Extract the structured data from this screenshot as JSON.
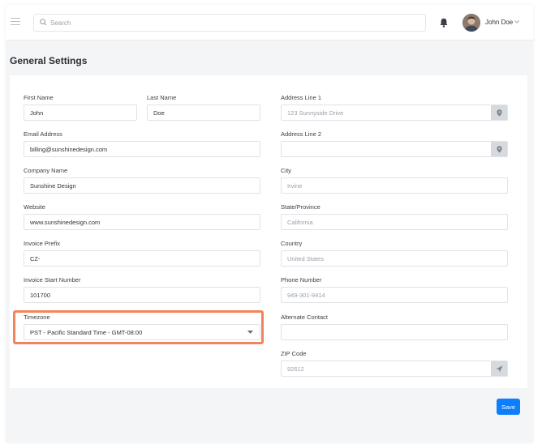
{
  "search": {
    "placeholder": "Search"
  },
  "user": {
    "name": "John Doe"
  },
  "page": {
    "title": "General Settings"
  },
  "form": {
    "first_name": {
      "label": "First Name",
      "value": "John"
    },
    "last_name": {
      "label": "Last Name",
      "value": "Doe"
    },
    "email": {
      "label": "Email Address",
      "value": "billing@sunshinedesign.com"
    },
    "company": {
      "label": "Company Name",
      "value": "Sunshine Design"
    },
    "website": {
      "label": "Website",
      "value": "www.sunshinedesign.com"
    },
    "invoice_prefix": {
      "label": "Invoice Prefix",
      "value": "CZ-"
    },
    "invoice_start": {
      "label": "Invoice Start Number",
      "value": "101700"
    },
    "timezone": {
      "label": "Timezone",
      "value": "PST - Pacific Standard Time - GMT-08:00"
    },
    "address1": {
      "label": "Address Line 1",
      "placeholder": "123 Sunnyside Drive"
    },
    "address2": {
      "label": "Address Line 2",
      "placeholder": ""
    },
    "city": {
      "label": "City",
      "placeholder": "Irvine"
    },
    "state": {
      "label": "State/Province",
      "placeholder": "California"
    },
    "country": {
      "label": "Country",
      "placeholder": "United States"
    },
    "phone": {
      "label": "Phone Number",
      "placeholder": "949-301-9414"
    },
    "alt_contact": {
      "label": "Alternate Contact",
      "placeholder": ""
    },
    "zip": {
      "label": "ZIP Code",
      "placeholder": "92612"
    }
  },
  "actions": {
    "save_label": "Save"
  },
  "colors": {
    "primary": "#0d7efc",
    "highlight": "#f0845a",
    "addon": "#d6dadf"
  },
  "icons": {
    "menu": "hamburger-icon",
    "search": "search-icon",
    "bell": "bell-icon",
    "location": "map-pin-icon",
    "send": "send-icon"
  }
}
